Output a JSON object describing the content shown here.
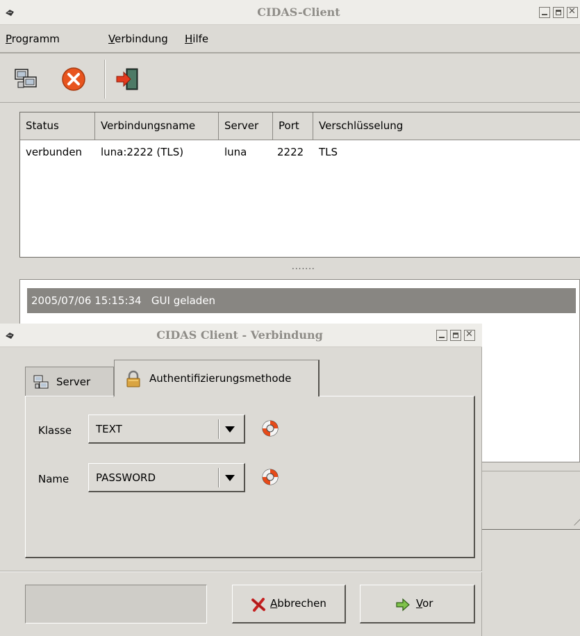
{
  "main_window": {
    "title": "CIDAS-Client",
    "menu": [
      {
        "mnemonic": "P",
        "rest": "rogramm"
      },
      {
        "mnemonic": "V",
        "rest": "erbindung"
      },
      {
        "mnemonic": "H",
        "rest": "ilfe"
      }
    ],
    "toolbar": [
      "connect-icon",
      "disconnect-icon",
      "exit-icon"
    ],
    "table": {
      "columns": [
        "Status",
        "Verbindungsname",
        "Server",
        "Port",
        "Verschlüsselung"
      ],
      "rows": [
        [
          "verbunden",
          "luna:2222 (TLS)",
          "luna",
          "2222",
          "TLS"
        ]
      ]
    },
    "log": [
      {
        "timestamp": "2005/07/06 15:15:34",
        "message": "GUI geladen"
      }
    ]
  },
  "dialog": {
    "title": "CIDAS Client - Verbindung",
    "tabs": [
      {
        "label": "Server",
        "icon": "server-icon",
        "active": false
      },
      {
        "label": "Authentifizierungsmethode",
        "icon": "padlock-icon",
        "active": true
      }
    ],
    "fields": [
      {
        "label": "Klasse",
        "value": "TEXT"
      },
      {
        "label": "Name",
        "value": "PASSWORD"
      }
    ],
    "buttons": {
      "cancel": {
        "mnemonic": "A",
        "rest": "bbrechen"
      },
      "next": {
        "mnemonic": "V",
        "rest": "or"
      }
    }
  },
  "colors": {
    "window_bg": "#dcdad5",
    "log_highlight": "#888682",
    "title_text": "#8e8c87"
  }
}
